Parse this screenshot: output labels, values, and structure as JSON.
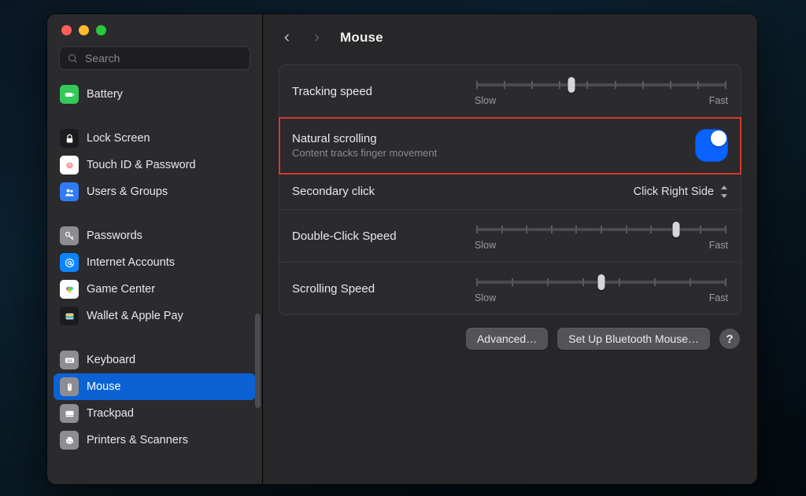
{
  "window_controls": {
    "close": "close",
    "min": "minimize",
    "max": "maximize"
  },
  "search": {
    "placeholder": "Search"
  },
  "sidebar": {
    "items": [
      {
        "id": "battery",
        "label": "Battery",
        "icon": "battery-icon",
        "bg": "#34c85a",
        "group": 0
      },
      {
        "id": "lockscreen",
        "label": "Lock Screen",
        "icon": "lock-icon",
        "bg": "#1c1c1e",
        "group": 1
      },
      {
        "id": "touchid",
        "label": "Touch ID & Password",
        "icon": "fingerprint-icon",
        "bg": "#ffffff",
        "group": 1
      },
      {
        "id": "users",
        "label": "Users & Groups",
        "icon": "users-icon",
        "bg": "#2f7af6",
        "group": 1
      },
      {
        "id": "passwords",
        "label": "Passwords",
        "icon": "key-icon",
        "bg": "#8e8d92",
        "group": 2
      },
      {
        "id": "internetaccounts",
        "label": "Internet Accounts",
        "icon": "at-icon",
        "bg": "#0a84ff",
        "group": 2
      },
      {
        "id": "gamecenter",
        "label": "Game Center",
        "icon": "gamecenter-icon",
        "bg": "#ffffff",
        "group": 2
      },
      {
        "id": "wallet",
        "label": "Wallet & Apple Pay",
        "icon": "wallet-icon",
        "bg": "#1c1c1e",
        "group": 2
      },
      {
        "id": "keyboard",
        "label": "Keyboard",
        "icon": "keyboard-icon",
        "bg": "#8e8d92",
        "group": 3
      },
      {
        "id": "mouse",
        "label": "Mouse",
        "icon": "mouse-icon",
        "bg": "#8e8d92",
        "group": 3,
        "active": true
      },
      {
        "id": "trackpad",
        "label": "Trackpad",
        "icon": "trackpad-icon",
        "bg": "#8e8d92",
        "group": 3
      },
      {
        "id": "printers",
        "label": "Printers & Scanners",
        "icon": "printer-icon",
        "bg": "#8e8d92",
        "group": 3
      }
    ]
  },
  "header": {
    "title": "Mouse"
  },
  "rows": {
    "tracking": {
      "label": "Tracking speed",
      "min": "Slow",
      "max": "Fast",
      "value_pct": 38,
      "ticks": 10
    },
    "natural": {
      "label": "Natural scrolling",
      "sub": "Content tracks finger movement",
      "on": true,
      "highlight": true
    },
    "secondary": {
      "label": "Secondary click",
      "value": "Click Right Side"
    },
    "double": {
      "label": "Double-Click Speed",
      "min": "Slow",
      "max": "Fast",
      "value_pct": 80,
      "ticks": 11
    },
    "scroll": {
      "label": "Scrolling Speed",
      "min": "Slow",
      "max": "Fast",
      "value_pct": 50,
      "ticks": 8
    }
  },
  "footer": {
    "advanced": "Advanced…",
    "bluetooth": "Set Up Bluetooth Mouse…",
    "help": "?"
  }
}
